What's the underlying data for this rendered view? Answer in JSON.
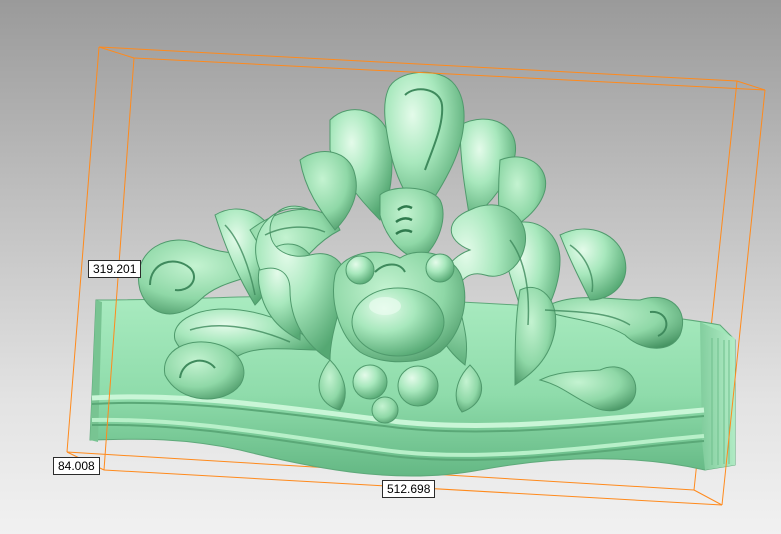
{
  "dimensions": {
    "height": "319.201",
    "depth": "84.008",
    "width": "512.698"
  },
  "colors": {
    "bounding_box": "#ff8a1c",
    "model": "#9fe3b4",
    "model_shadow": "#5fb27c",
    "model_highlight": "#d7f7e0"
  },
  "object": "carved-ornament-relief"
}
